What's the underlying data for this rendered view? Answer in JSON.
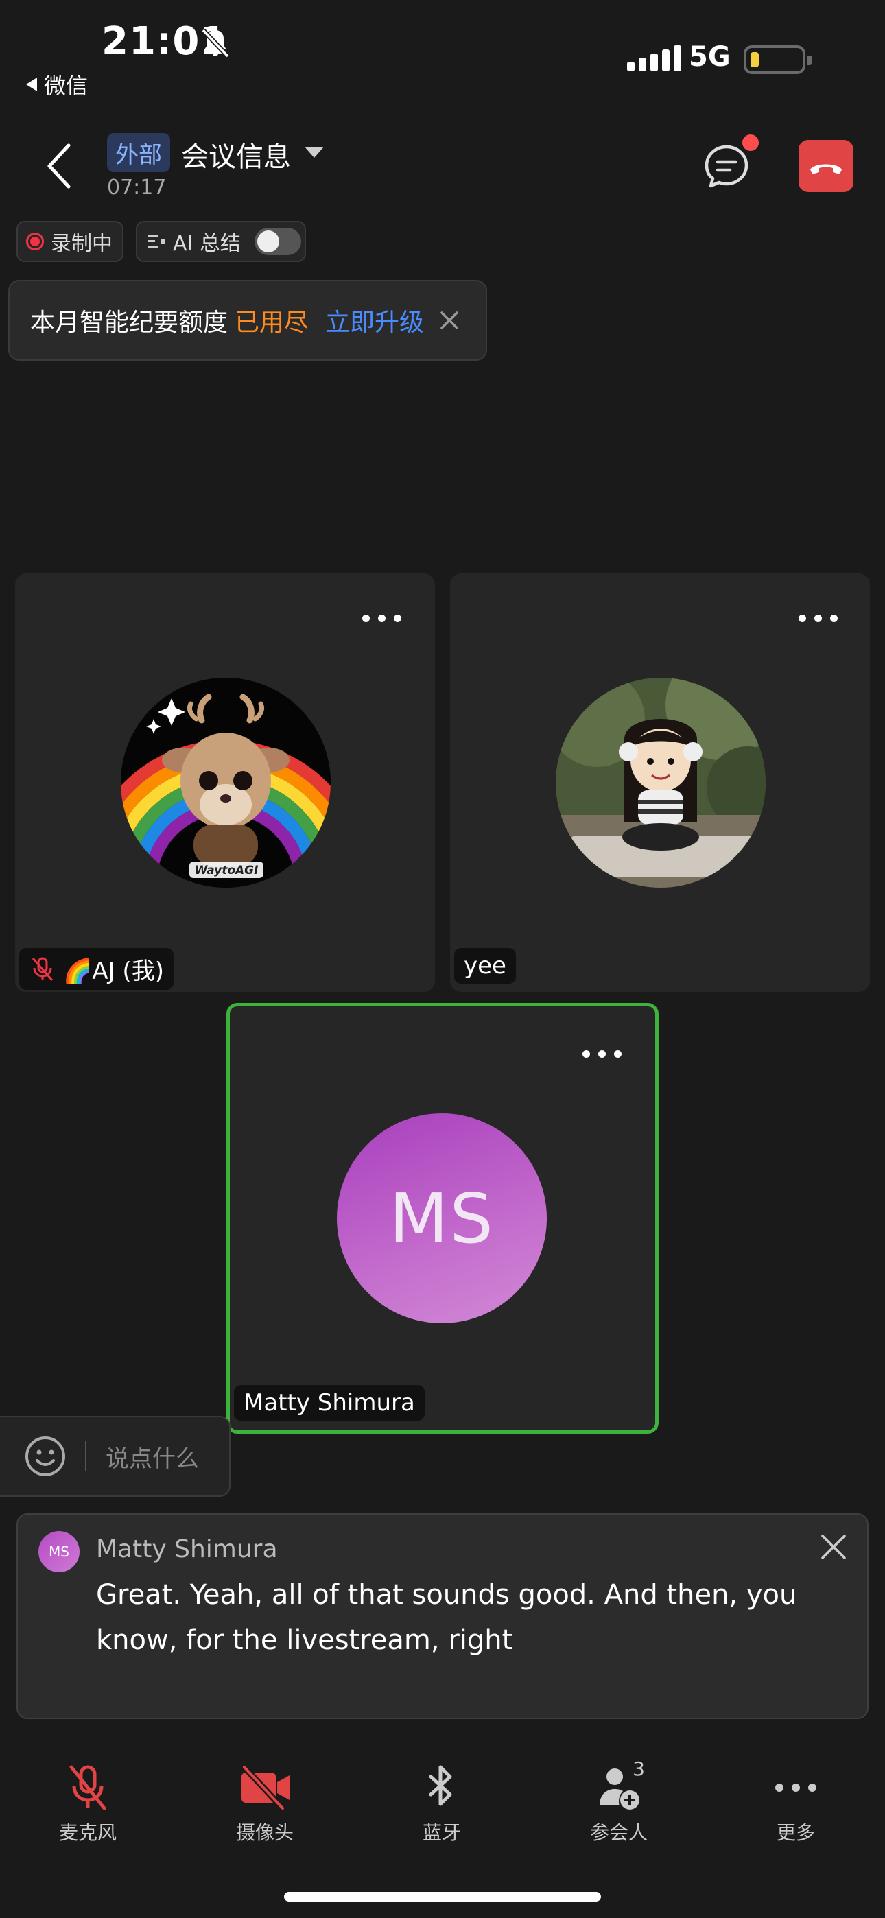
{
  "status_bar": {
    "time": "21:01",
    "back_app": "微信",
    "network": "5G"
  },
  "header": {
    "badge": "外部",
    "title": "会议信息",
    "duration": "07:17"
  },
  "recording": {
    "rec_label": "录制中",
    "ai_label": "AI 总结",
    "ai_toggle_on": false
  },
  "quota_toast": {
    "text": "本月智能纪要额度",
    "status": "已用尽",
    "action": "立即升级"
  },
  "participants": [
    {
      "name": "🌈AJ (我)",
      "muted": true,
      "avatar_text": "WaytoAGI"
    },
    {
      "name": "yee",
      "muted": false
    },
    {
      "name": "Matty Shimura",
      "initials": "MS",
      "speaking": true
    }
  ],
  "comment_box": {
    "placeholder": "说点什么"
  },
  "caption": {
    "speaker": "Matty Shimura",
    "initials": "MS",
    "text": "Great. Yeah, all of that sounds good. And then, you know, for the livestream, right"
  },
  "toolbar": [
    {
      "label": "麦克风",
      "icon": "mic-off-icon"
    },
    {
      "label": "摄像头",
      "icon": "camera-off-icon"
    },
    {
      "label": "蓝牙",
      "icon": "bluetooth-icon"
    },
    {
      "label": "参会人",
      "icon": "participants-icon",
      "count": "3"
    },
    {
      "label": "更多",
      "icon": "more-icon"
    }
  ],
  "colors": {
    "accent_blue": "#4a8cff",
    "warning_orange": "#ff8a1f",
    "hangup_red": "#e04444",
    "speaking_green": "#3db33d",
    "ms_avatar": "#b44cc4"
  }
}
